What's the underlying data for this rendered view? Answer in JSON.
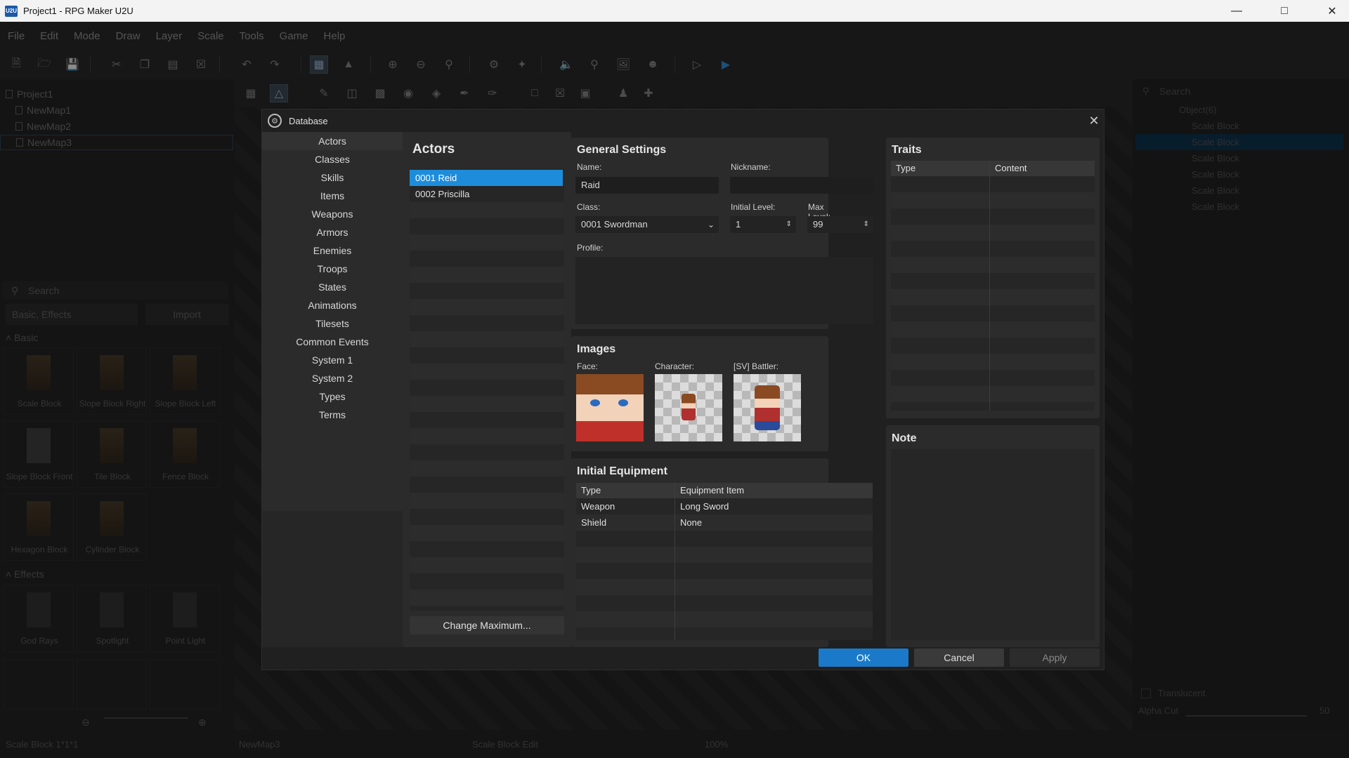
{
  "window": {
    "title": "Project1 - RPG Maker U2U",
    "app_badge": "U2U"
  },
  "menu": [
    "File",
    "Edit",
    "Mode",
    "Draw",
    "Layer",
    "Scale",
    "Tools",
    "Game",
    "Help"
  ],
  "project_tree": {
    "root": "Project1",
    "maps": [
      "NewMap1",
      "NewMap2",
      "NewMap3"
    ]
  },
  "asset_panel": {
    "search_placeholder": "Search",
    "filter_value": "Basic, Effects",
    "import_label": "Import",
    "sections": [
      {
        "title": "Basic",
        "items": [
          "Scale Block",
          "Slope Block Right",
          "Slope Block Left",
          "Slope Block Front",
          "Tile Block",
          "Fence Block",
          "Hexagon Block",
          "Cylinder Block"
        ]
      },
      {
        "title": "Effects",
        "items": [
          "God Rays",
          "Spotlight",
          "Point Light"
        ]
      }
    ]
  },
  "object_panel": {
    "search_placeholder": "Search",
    "group": "Object(6)",
    "items": [
      "Scale Block",
      "Scale Block",
      "Scale Block",
      "Scale Block",
      "Scale Block",
      "Scale Block"
    ],
    "translucent_label": "Translucent",
    "alpha_label": "Alpha Cut",
    "alpha_value": "50"
  },
  "status": {
    "left": "Scale Block 1*1*1",
    "map": "NewMap3",
    "mode": "Scale Block Edit",
    "zoom": "100%"
  },
  "dialog": {
    "title": "Database",
    "categories": [
      "Actors",
      "Classes",
      "Skills",
      "Items",
      "Weapons",
      "Armors",
      "Enemies",
      "Troops",
      "States",
      "Animations",
      "Tilesets",
      "Common Events",
      "System 1",
      "System 2",
      "Types",
      "Terms"
    ],
    "selected_category": "Actors",
    "actors_title": "Actors",
    "actors": [
      "0001 Reid",
      "0002 Priscilla"
    ],
    "change_max_label": "Change Maximum...",
    "general": {
      "title": "General Settings",
      "name_label": "Name:",
      "name_value": "Raid",
      "nickname_label": "Nickname:",
      "nickname_value": "",
      "class_label": "Class:",
      "class_value": "0001 Swordman",
      "initial_level_label": "Initial Level:",
      "initial_level_value": "1",
      "max_level_label": "Max Level:",
      "max_level_value": "99",
      "profile_label": "Profile:"
    },
    "images": {
      "title": "Images",
      "face_label": "Face:",
      "character_label": "Character:",
      "battler_label": "[SV] Battler:"
    },
    "equipment": {
      "title": "Initial Equipment",
      "headers": [
        "Type",
        "Equipment Item"
      ],
      "rows": [
        {
          "type": "Weapon",
          "item": "Long Sword"
        },
        {
          "type": "Shield",
          "item": "None"
        }
      ]
    },
    "traits": {
      "title": "Traits",
      "headers": [
        "Type",
        "Content"
      ]
    },
    "note": {
      "title": "Note"
    },
    "buttons": {
      "ok": "OK",
      "cancel": "Cancel",
      "apply": "Apply"
    }
  }
}
